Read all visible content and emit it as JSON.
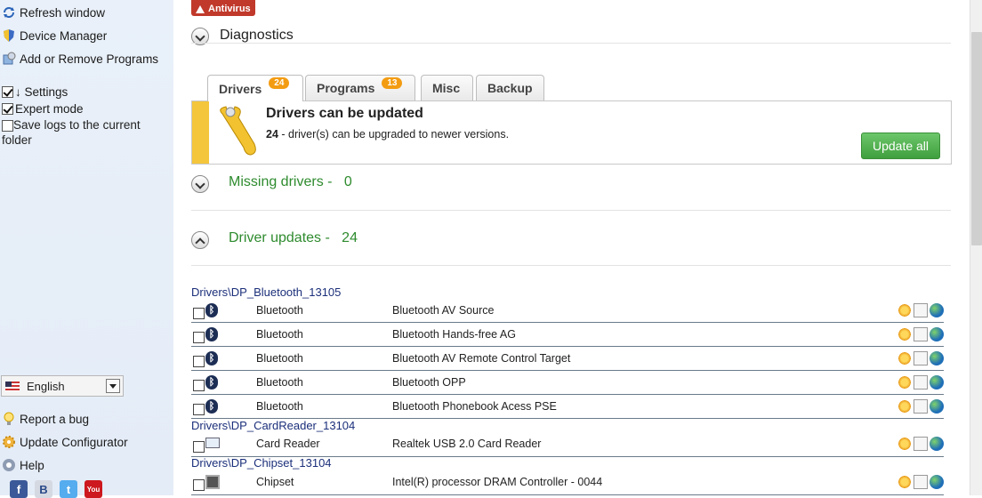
{
  "sidebar": {
    "refresh": "Refresh window",
    "device_manager": "Device Manager",
    "add_remove": "Add or Remove Programs",
    "settings": "↓ Settings",
    "expert_mode": "Expert mode",
    "save_logs": "Save logs to the current folder",
    "language": "English",
    "report_bug": "Report a bug",
    "update_configurator": "Update Configurator",
    "help": "Help",
    "social": [
      "f",
      "B",
      "t",
      "You"
    ]
  },
  "main": {
    "antivirus_badge": "Antivirus",
    "diagnostics": "Diagnostics",
    "tabs": [
      {
        "label": "Drivers",
        "count": "24"
      },
      {
        "label": "Programs",
        "count": "13"
      },
      {
        "label": "Misc"
      },
      {
        "label": "Backup"
      }
    ],
    "panel": {
      "title": "Drivers can be updated",
      "count": "24",
      "message": " - driver(s) can be upgraded to newer versions.",
      "button": "Update all"
    },
    "missing_drivers": {
      "label": "Missing drivers -",
      "count": "0"
    },
    "driver_updates": {
      "label": "Driver updates -",
      "count": "24"
    },
    "groups": [
      {
        "path": "Drivers\\DP_Bluetooth_13105",
        "rows": [
          {
            "cat": "Bluetooth",
            "name": "Bluetooth AV Source"
          },
          {
            "cat": "Bluetooth",
            "name": "Bluetooth Hands-free AG"
          },
          {
            "cat": "Bluetooth",
            "name": "Bluetooth AV Remote Control Target"
          },
          {
            "cat": "Bluetooth",
            "name": "Bluetooth OPP"
          },
          {
            "cat": "Bluetooth",
            "name": "Bluetooth Phonebook Acess PSE"
          }
        ]
      },
      {
        "path": "Drivers\\DP_CardReader_13104",
        "rows": [
          {
            "cat": "Card Reader",
            "name": "Realtek USB 2.0 Card Reader"
          }
        ]
      },
      {
        "path": "Drivers\\DP_Chipset_13104",
        "rows": [
          {
            "cat": "Chipset",
            "name": "Intel(R) processor DRAM Controller - 0044"
          }
        ]
      }
    ]
  },
  "colors": {
    "accent_green": "#2e8b2e",
    "badge_orange": "#f39c12",
    "antivirus_red": "#c0392b"
  }
}
